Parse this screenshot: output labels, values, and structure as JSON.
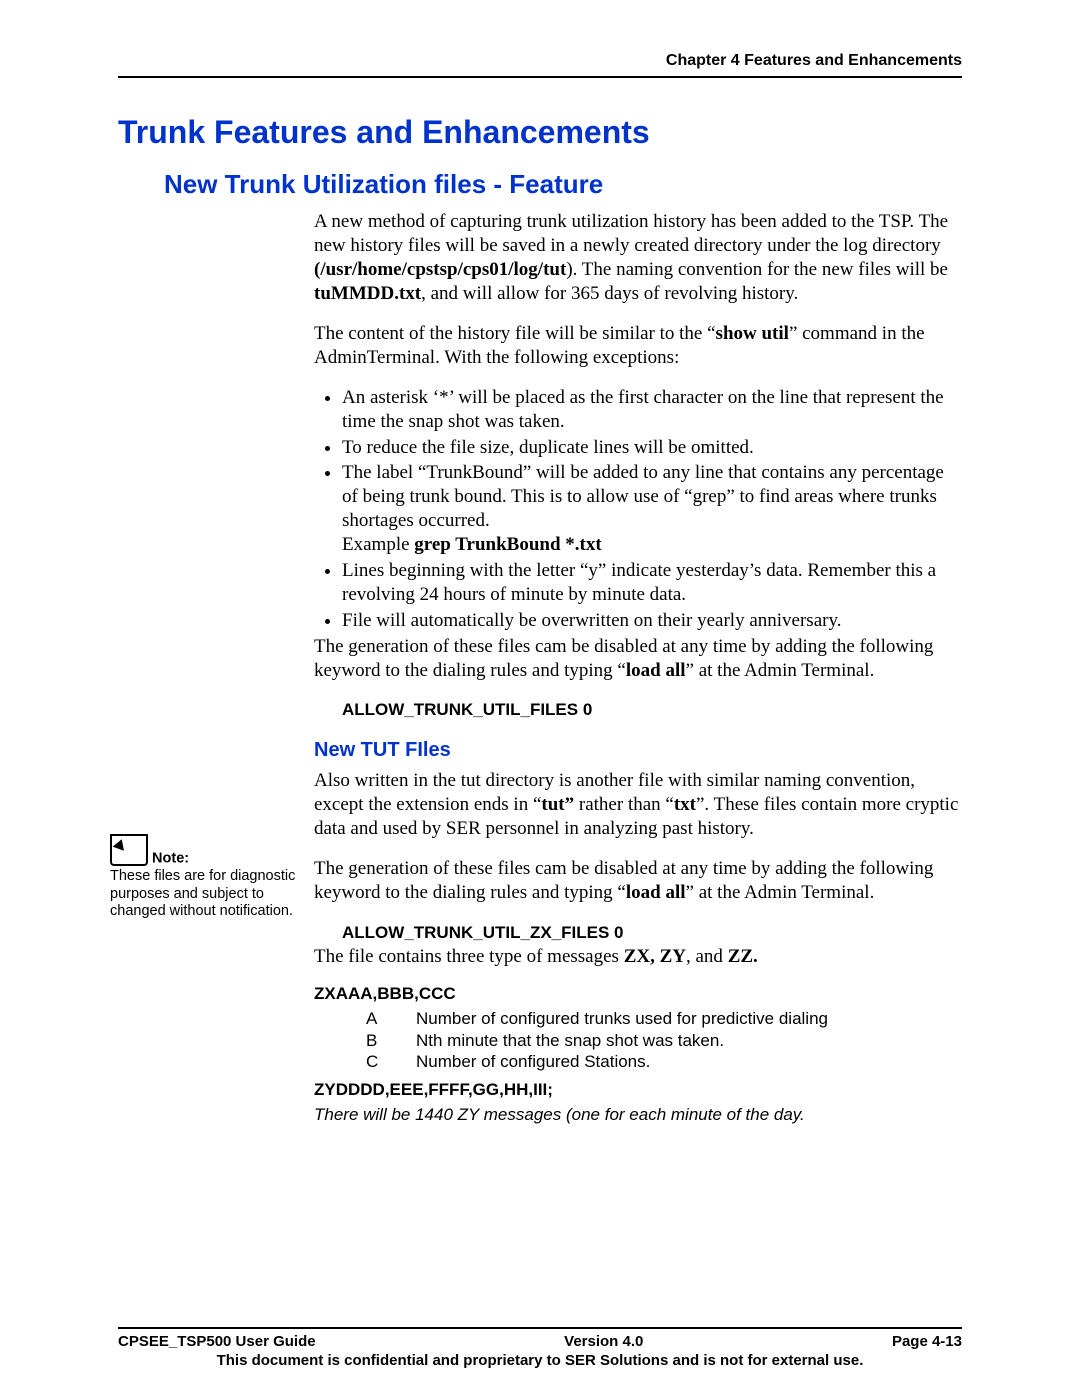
{
  "header": {
    "chapter": "Chapter 4 Features and Enhancements"
  },
  "title": "Trunk Features and Enhancements",
  "subtitle": "New Trunk Utilization files - Feature",
  "p1_a": "A new method of capturing trunk utilization history has been added to the TSP.  The new history files will be saved in a newly created directory under the log directory ",
  "p1_dir": "(/usr/home/cpstsp/cps01/log/tut",
  "p1_b": ").  The naming convention for the new files will be ",
  "p1_fname": "tuMMDD.txt",
  "p1_c": ", and will allow for 365 days of revolving history.",
  "p2_a": "The content of the history file will be similar to the “",
  "p2_cmd": "show util",
  "p2_b": "”  command in the AdminTerminal.  With the following exceptions:",
  "bullets": {
    "b1": "An asterisk ‘*’ will be placed as the first character on the line that represent the time the snap shot was taken.",
    "b2": "To reduce the file size, duplicate lines will be omitted.",
    "b3": "The label “TrunkBound” will be added to any line that contains any percentage of being trunk bound. This is to allow  use of “grep”  to find areas where trunks shortages occurred.",
    "b3_ex_label": "Example     ",
    "b3_ex_cmd": "grep  TrunkBound   *.txt",
    "b4": "Lines beginning with the letter “y” indicate yesterday’s data.   Remember this a revolving 24 hours of minute by minute data.",
    "b5": "File will automatically be overwritten on their yearly anniversary."
  },
  "p3_a": "The generation of these files cam be disabled at any time by adding the following keyword to the dialing rules and typing “",
  "p3_cmd": "load all",
  "p3_b": "” at the Admin Terminal.",
  "kw1": "ALLOW_TRUNK_UTIL_FILES   0",
  "section2": "New TUT FIles",
  "s2_p1_a": "Also written in the tut directory is another file with similar naming convention, except the extension ends in  “",
  "s2_p1_tut": "tut”",
  "s2_p1_b": " rather than “",
  "s2_p1_txt": "txt",
  "s2_p1_c": "”.  These files contain more cryptic data and used by SER personnel in analyzing past history.",
  "s2_p2_a": "The generation of these files cam be disabled at any time by adding the following keyword to the dialing rules and typing “",
  "s2_p2_cmd": "load all",
  "s2_p2_b": "” at the Admin Terminal.",
  "kw2": "ALLOW_TRUNK_UTIL_ZX_FILES   0",
  "msg_line_a": "The file contains three type of messages ",
  "msg_line_b": "ZX, ZY",
  "msg_line_c": ", and ",
  "msg_line_d": "ZZ.",
  "zx_hdr": "ZXAAA,BBB,CCC",
  "abc": {
    "a_l": "A",
    "a_t": "Number of configured trunks used for predictive dialing",
    "b_l": "B",
    "b_t": "Nth minute that the snap shot was taken.",
    "c_l": "C",
    "c_t": "Number of configured Stations."
  },
  "zy_hdr": "ZYDDDD,EEE,FFFF,GG,HH,III;",
  "zy_note": "There will be 1440 ZY messages (one for each minute of the day.",
  "sidenote": {
    "title": "Note:",
    "body": "These files are for diagnostic purposes and subject to changed without notification."
  },
  "footer": {
    "left": "CPSEE_TSP500 User Guide",
    "center": "Version 4.0",
    "right": "Page 4-13",
    "conf": "This document is confidential and proprietary to SER Solutions and is not for external use."
  }
}
